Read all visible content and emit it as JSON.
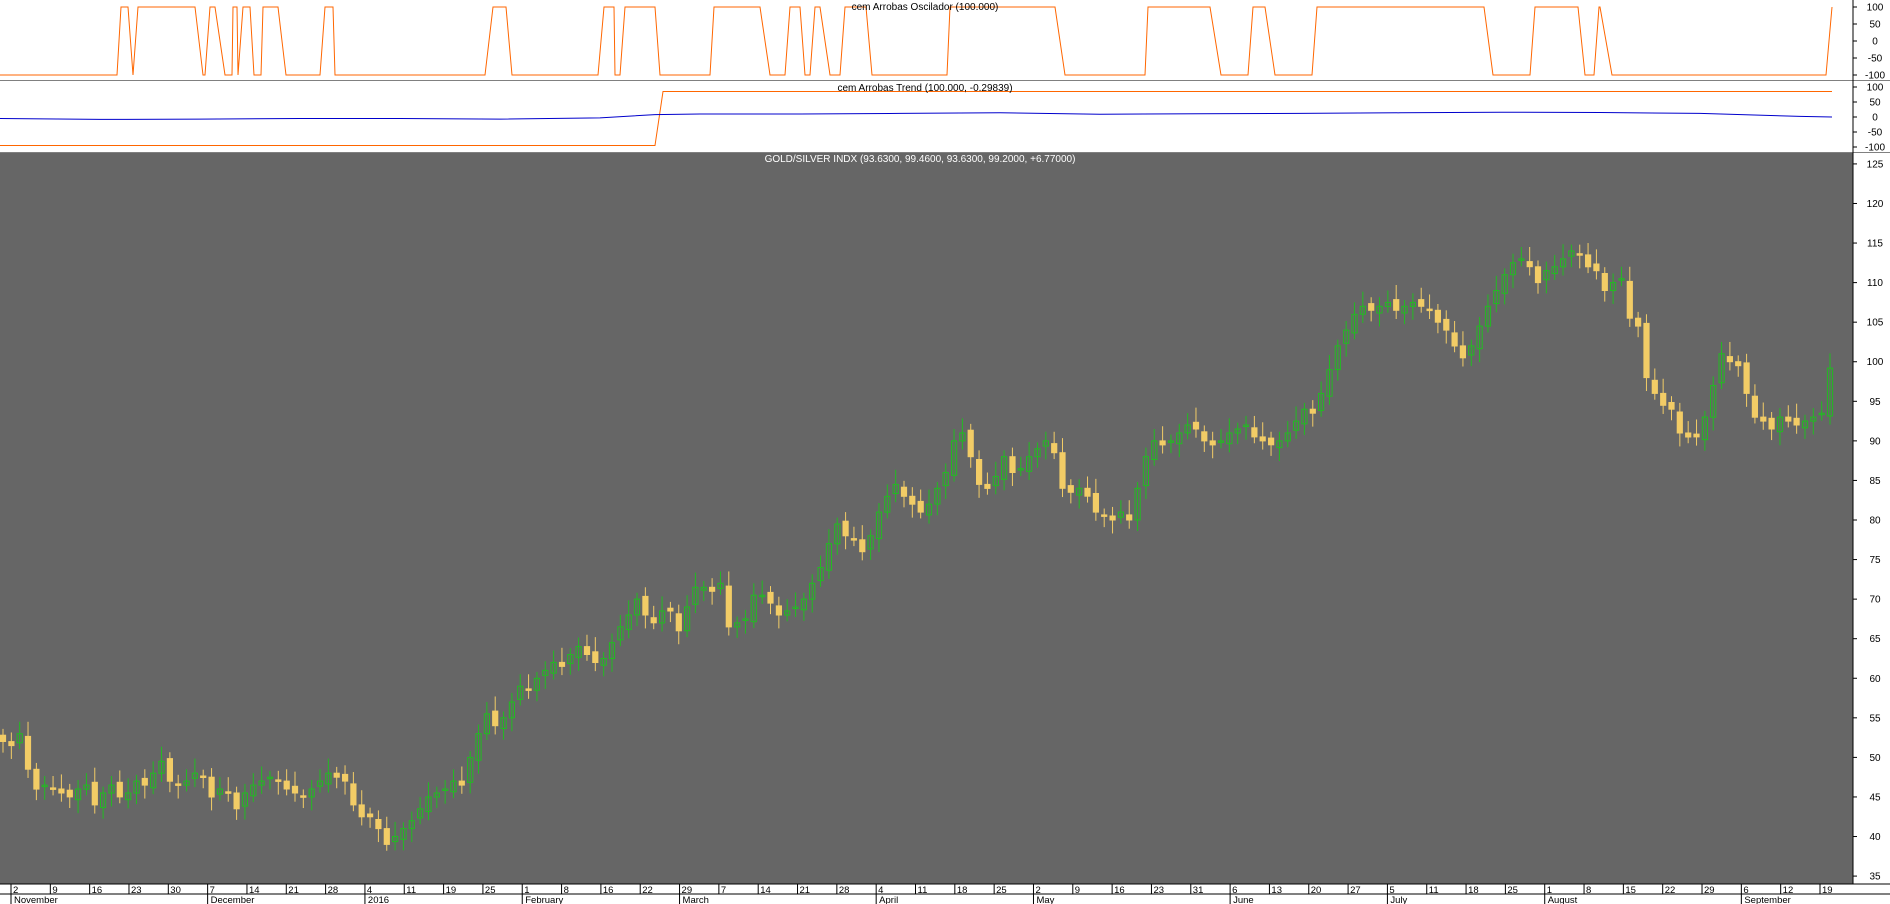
{
  "chart_data": [
    {
      "type": "line",
      "title": "cem Arrobas Oscilador (100.000)",
      "ylim": [
        -100,
        100
      ],
      "yticks": [
        "100",
        "50",
        "0",
        "-50",
        "-100"
      ],
      "colors": {
        "line": "#ff6600"
      },
      "x_index": [
        0,
        117,
        121,
        128,
        133,
        138,
        195,
        203,
        205,
        210,
        215,
        225,
        232,
        233,
        237,
        238,
        243,
        250,
        254,
        261,
        263,
        267,
        278,
        286,
        320,
        325,
        333,
        335,
        340,
        344,
        485,
        493,
        506,
        512,
        540,
        580,
        598,
        604,
        614,
        615,
        620,
        625,
        655,
        660,
        710,
        714,
        760,
        770,
        785,
        790,
        800,
        805,
        810,
        815,
        820,
        830,
        840,
        845,
        866,
        872,
        880,
        885,
        947,
        950,
        1055,
        1065,
        1145,
        1148,
        1210,
        1221,
        1248,
        1253,
        1265,
        1275,
        1312,
        1317,
        1484,
        1493,
        1530,
        1535,
        1578,
        1585,
        1594,
        1599,
        1600,
        1612,
        1826,
        1832
      ],
      "values": [
        -100,
        -100,
        100,
        100,
        -100,
        100,
        100,
        -100,
        -100,
        100,
        100,
        -100,
        -100,
        100,
        100,
        -100,
        100,
        100,
        -100,
        -100,
        100,
        100,
        100,
        -100,
        -100,
        100,
        100,
        -100,
        -100,
        -100,
        -100,
        100,
        100,
        -100,
        -100,
        -100,
        -100,
        100,
        100,
        -100,
        -100,
        100,
        100,
        -100,
        -100,
        100,
        100,
        -100,
        -100,
        100,
        100,
        -100,
        -100,
        100,
        100,
        -100,
        -100,
        100,
        100,
        -100,
        -100,
        -100,
        -100,
        100,
        100,
        -100,
        -100,
        100,
        100,
        -100,
        -100,
        100,
        100,
        -100,
        -100,
        100,
        100,
        -100,
        -100,
        100,
        100,
        -100,
        -100,
        100,
        100,
        -100,
        -100,
        100
      ]
    },
    {
      "type": "line",
      "title": "cem Arrobas Trend (100.000, -0.29839)",
      "ylim": [
        -100,
        100
      ],
      "yticks": [
        "100",
        "50",
        "0",
        "-50",
        "-100"
      ],
      "series": [
        {
          "color": "#ff6600",
          "x_index": [
            0,
            655,
            663,
            1832
          ],
          "values": [
            -95,
            -95,
            85,
            85
          ]
        },
        {
          "color": "#0000cc",
          "x_index": [
            0,
            100,
            200,
            300,
            400,
            500,
            600,
            655,
            700,
            800,
            900,
            1000,
            1100,
            1200,
            1300,
            1400,
            1500,
            1600,
            1700,
            1800,
            1832
          ],
          "values": [
            -5,
            -8,
            -7,
            -5,
            -5,
            -7,
            -3,
            8,
            10,
            10,
            12,
            14,
            9,
            11,
            12,
            14,
            16,
            15,
            12,
            2,
            0
          ]
        }
      ]
    },
    {
      "type": "candlestick",
      "title": "GOLD/SILVER INDX (93.6300, 99.4600, 93.6300, 99.2000, +6.77000)",
      "ylim": [
        34,
        126
      ],
      "yticks": [
        "125",
        "120",
        "115",
        "110",
        "105",
        "100",
        "95",
        "90",
        "85",
        "80",
        "75",
        "70",
        "65",
        "60",
        "55",
        "50",
        "45",
        "40",
        "35"
      ],
      "colors": {
        "up": "#22bb22",
        "down": "#f2cc66",
        "background": "#666666"
      },
      "x_ticks": [
        "2",
        "9",
        "16",
        "23",
        "30",
        "7",
        "14",
        "21",
        "28",
        "4",
        "11",
        "19",
        "25",
        "1",
        "8",
        "16",
        "22",
        "29",
        "7",
        "14",
        "21",
        "28",
        "4",
        "11",
        "18",
        "25",
        "2",
        "9",
        "16",
        "23",
        "31",
        "6",
        "13",
        "20",
        "27",
        "5",
        "11",
        "18",
        "25",
        "1",
        "8",
        "15",
        "22",
        "29",
        "6",
        "12",
        "19"
      ],
      "x_months": [
        "November",
        "December",
        "2016",
        "February",
        "March",
        "April",
        "May",
        "June",
        "July",
        "August",
        "September"
      ],
      "x_month_tick_index": [
        0,
        5,
        9,
        13,
        17,
        22,
        26,
        31,
        35,
        39,
        44
      ],
      "close": [
        52,
        51.5,
        53,
        48.5,
        46,
        46.5,
        46,
        45.5,
        45,
        46,
        46.5,
        44,
        45.5,
        46.5,
        45,
        45.5,
        47,
        46.5,
        48,
        49.5,
        47,
        46.5,
        47,
        48,
        47.5,
        45,
        46,
        45.5,
        43.5,
        45.5,
        46.5,
        47,
        47.5,
        47,
        46,
        45.5,
        45,
        46,
        47,
        48,
        47.5,
        47,
        44,
        42.5,
        42.5,
        41,
        39,
        40,
        41,
        42,
        43.5,
        45,
        45.5,
        46,
        47,
        46.5,
        50,
        53,
        55.5,
        54,
        55,
        57,
        59,
        58.5,
        60,
        61,
        62,
        61.5,
        63,
        64,
        63,
        62,
        62.5,
        64.5,
        66.5,
        68,
        70,
        68,
        67,
        68.5,
        68.5,
        66,
        69,
        71.5,
        71.5,
        71,
        72,
        66.5,
        67,
        67.5,
        70.5,
        70.5,
        69.5,
        68,
        68.5,
        69,
        70,
        72,
        74,
        77,
        79.5,
        78,
        77.5,
        76,
        78,
        81,
        83,
        84.5,
        83,
        82,
        81,
        82,
        84,
        86,
        90,
        91,
        88,
        84.5,
        84,
        85.5,
        88,
        86,
        86.5,
        88,
        89,
        90,
        88.5,
        84,
        83.5,
        84,
        83,
        81,
        80.5,
        80,
        81,
        80,
        84,
        88,
        90,
        89.5,
        90,
        91,
        92,
        91.5,
        90,
        89.5,
        90,
        91,
        91.5,
        92,
        90.5,
        90,
        89.5,
        90,
        91,
        92.5,
        94,
        93.5,
        96,
        99,
        102,
        104,
        106,
        107,
        106.5,
        107,
        107.5,
        106.5,
        107,
        107.5,
        107,
        106.5,
        105,
        104,
        102,
        100.5,
        102,
        104.5,
        107,
        109,
        111,
        112.5,
        113,
        112,
        110,
        111.5,
        112,
        113,
        114,
        113.5,
        112,
        111.5,
        109,
        110,
        110.5,
        105.5,
        104.5,
        98,
        96,
        94.5,
        94,
        91,
        90.5,
        90.5,
        93,
        97,
        101,
        100,
        99.5,
        96,
        93,
        92.5,
        91.5,
        93,
        92.5,
        92,
        92.5,
        93,
        93.5,
        99.2
      ]
    }
  ]
}
